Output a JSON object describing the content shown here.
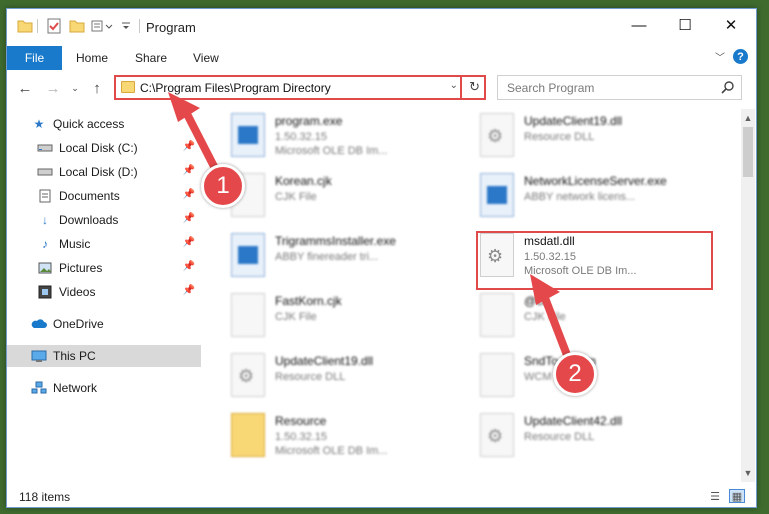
{
  "window": {
    "title": "Program",
    "minimize_glyph": "—",
    "maximize_glyph": "☐",
    "close_glyph": "✕"
  },
  "ribbon": {
    "file_tab": "File",
    "tabs": [
      "Home",
      "Share",
      "View"
    ]
  },
  "address": {
    "path": "C:\\Program Files\\Program Directory"
  },
  "search": {
    "placeholder": "Search Program"
  },
  "sidebar": {
    "items": [
      {
        "label": "Quick access",
        "icon": "star-icon",
        "pinned": false
      },
      {
        "label": "Local Disk (C:)",
        "icon": "drive-icon",
        "pinned": true
      },
      {
        "label": "Local Disk (D:)",
        "icon": "drive-icon",
        "pinned": true
      },
      {
        "label": "Documents",
        "icon": "documents-icon",
        "pinned": true
      },
      {
        "label": "Downloads",
        "icon": "downloads-icon",
        "pinned": true
      },
      {
        "label": "Music",
        "icon": "music-icon",
        "pinned": true
      },
      {
        "label": "Pictures",
        "icon": "pictures-icon",
        "pinned": true
      },
      {
        "label": "Videos",
        "icon": "videos-icon",
        "pinned": true
      },
      {
        "label": "OneDrive",
        "icon": "onedrive-icon",
        "pinned": false
      },
      {
        "label": "This PC",
        "icon": "computer-icon",
        "pinned": false,
        "selected": true
      },
      {
        "label": "Network",
        "icon": "network-icon",
        "pinned": false
      }
    ]
  },
  "files": [
    {
      "name": "program.exe",
      "sub1": "1.50.32.15",
      "sub2": "Microsoft OLE DB Im...",
      "type": "exe"
    },
    {
      "name": "UpdateClient19.dll",
      "sub1": "Resource DLL",
      "sub2": "",
      "type": "dll"
    },
    {
      "name": "Korean.cjk",
      "sub1": "CJK File",
      "sub2": "",
      "type": "file"
    },
    {
      "name": "NetworkLicenseServer.exe",
      "sub1": "ABBY network licens...",
      "sub2": "",
      "type": "exe"
    },
    {
      "name": "TrigrammsInstaller.exe",
      "sub1": "ABBY finereader tri...",
      "sub2": "",
      "type": "exe"
    },
    {
      "name": "msdatl.dll",
      "sub1": "1.50.32.15",
      "sub2": "Microsoft OLE DB Im...",
      "type": "dll",
      "highlighted": true
    },
    {
      "name": "FastKorn.cjk",
      "sub1": "CJK File",
      "sub2": "",
      "type": "file"
    },
    {
      "name": "@ck",
      "sub1": "CJK File",
      "sub2": "",
      "type": "file"
    },
    {
      "name": "UpdateClient19.dll",
      "sub1": "Resource DLL",
      "sub2": "",
      "type": "dll"
    },
    {
      "name": "SndTo....wcm",
      "sub1": "WCM File",
      "sub2": "",
      "type": "file"
    },
    {
      "name": "Resource",
      "sub1": "1.50.32.15",
      "sub2": "Microsoft OLE DB Im...",
      "type": "folder"
    },
    {
      "name": "UpdateClient42.dll",
      "sub1": "Resource DLL",
      "sub2": "",
      "type": "dll"
    }
  ],
  "status": {
    "item_count": "118 items"
  },
  "annotations": {
    "step1": "1",
    "step2": "2",
    "color": "#e4484a"
  },
  "colors": {
    "accent": "#1979ca",
    "highlight": "#e04a4a"
  }
}
